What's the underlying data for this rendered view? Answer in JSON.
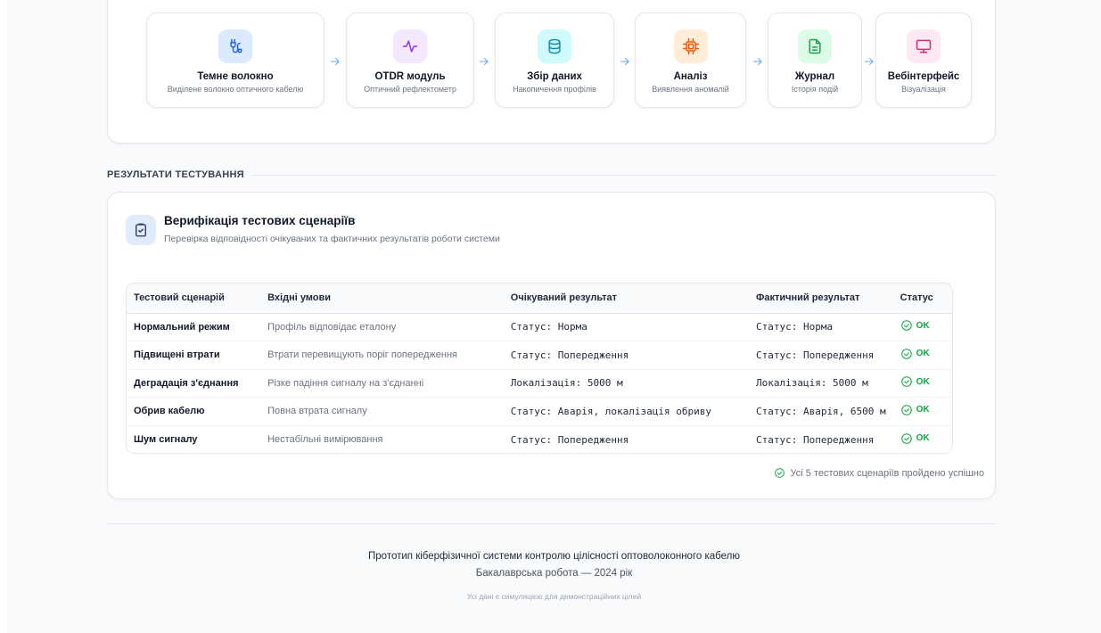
{
  "pipeline": {
    "steps": [
      {
        "title": "Темне волокно",
        "subtitle": "Виділене волокно оптичного кабелю",
        "icon": "cable-icon",
        "bg": "#dbeafe",
        "stroke": "#2563eb"
      },
      {
        "title": "OTDR модуль",
        "subtitle": "Оптичний рефлектометр",
        "icon": "pulse-icon",
        "bg": "#f3e8ff",
        "stroke": "#9333ea"
      },
      {
        "title": "Збір даних",
        "subtitle": "Накопичення профілів",
        "icon": "database-icon",
        "bg": "#cffafe",
        "stroke": "#0891b2"
      },
      {
        "title": "Аналіз",
        "subtitle": "Виявлення аномалій",
        "icon": "cpu-icon",
        "bg": "#ffedd5",
        "stroke": "#ea580c"
      },
      {
        "title": "Журнал",
        "subtitle": "Історія подій",
        "icon": "file-text-icon",
        "bg": "#dcfce7",
        "stroke": "#16a34a"
      },
      {
        "title": "Вебінтерфейс",
        "subtitle": "Візуалізація",
        "icon": "monitor-icon",
        "bg": "#fce7f3",
        "stroke": "#db2777"
      }
    ]
  },
  "section": {
    "heading": "РЕЗУЛЬТАТИ ТЕСТУВАННЯ"
  },
  "results": {
    "title": "Верифікація тестових сценаріїв",
    "subtitle": "Перевірка відповідності очікуваних та фактичних результатів роботи системи",
    "columns": [
      "Тестовий сценарій",
      "Вхідні умови",
      "Очікуваний результат",
      "Фактичний результат",
      "Статус"
    ],
    "rows": [
      {
        "scenario": "Нормальний режим",
        "input": "Профіль відповідає еталону",
        "expected": "Статус: Норма",
        "actual": "Статус: Норма",
        "status": "OK"
      },
      {
        "scenario": "Підвищені втрати",
        "input": "Втрати перевищують поріг попередження",
        "expected": "Статус: Попередження",
        "actual": "Статус: Попередження",
        "status": "OK"
      },
      {
        "scenario": "Деградація з'єднання",
        "input": "Різке падіння сигналу на з'єднанні",
        "expected": "Локалізація: 5000 м",
        "actual": "Локалізація: 5000 м",
        "status": "OK"
      },
      {
        "scenario": "Обрив кабелю",
        "input": "Повна втрата сигналу",
        "expected": "Статус: Аварія, локалізація обриву",
        "actual": "Статус: Аварія, 6500 м",
        "status": "OK"
      },
      {
        "scenario": "Шум сигналу",
        "input": "Нестабільні вимірювання",
        "expected": "Статус: Попередження",
        "actual": "Статус: Попередження",
        "status": "OK"
      }
    ],
    "summary": "Усі 5 тестових сценаріїв пройдено успішно",
    "status_color": "#16a34a"
  },
  "footer": {
    "title": "Прототип кіберфізичної системи контролю цілісності оптоволоконного кабелю",
    "subtitle": "Бакалаврська робота — 2024 рік",
    "note": "Усі дані є симуляцією для демонстраційних цілей"
  }
}
